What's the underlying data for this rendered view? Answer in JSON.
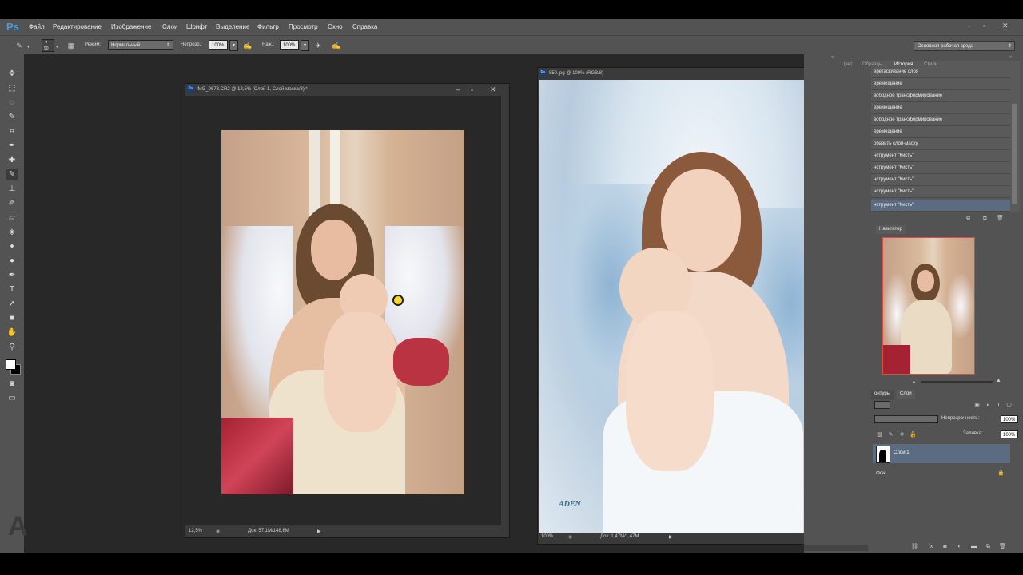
{
  "app": {
    "logo": "Ps"
  },
  "menu": [
    "Файл",
    "Редактирование",
    "Изображение",
    "Слои",
    "Шрифт",
    "Выделение",
    "Фильтр",
    "Просмотр",
    "Окно",
    "Справка"
  ],
  "options": {
    "brush_size": "90",
    "mode_label": "Режим:",
    "mode_value": "Нормальный",
    "opacity_label": "Непрозр.:",
    "opacity_value": "100%",
    "flow_label": "Наж.:",
    "flow_value": "100%",
    "workspace": "Основная рабочая среда"
  },
  "doc1": {
    "title": "IMG_0673.CR2 @ 12,5% (Слой 1, Слой-маска/8) *",
    "zoom": "12,5%",
    "size": "Док: 57,1M/148,8M"
  },
  "doc2": {
    "title": "850.jpg @ 100% (RGB/8)",
    "zoom": "100%",
    "size": "Док: 1,47M/1,47M",
    "signature": "ADEN"
  },
  "panel_tabs": [
    "Цвет",
    "Образцы",
    "История",
    "Стили"
  ],
  "history": [
    "еретаскивание слоя",
    "еремещение",
    "вободное трансформирование",
    "еремещение",
    "вободное трансформирование",
    "еремещение",
    "обавить слой-маску",
    "нструмент \"Кисть\"",
    "нструмент \"Кисть\"",
    "нструмент \"Кисть\"",
    "нструмент \"Кисть\"",
    "нструмент \"Кисть\""
  ],
  "navigator": {
    "tab": "Навигатор"
  },
  "layers": {
    "tabs": [
      "онтуры",
      "Слои"
    ],
    "opacity_label": "Непрозрачность:",
    "opacity_value": "100%",
    "fill_label": "Заливка:",
    "fill_value": "100%",
    "items": [
      "Слой 1",
      "Фон"
    ]
  },
  "watermark": "A",
  "colors": {
    "accent": "#4a9ce0",
    "history_selected": "#5a6b82",
    "layer_selected": "#5a6b82"
  }
}
